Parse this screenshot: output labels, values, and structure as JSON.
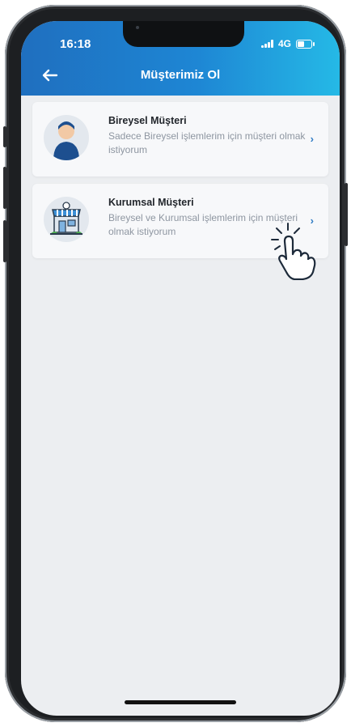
{
  "status_bar": {
    "time": "16:18",
    "network": "4G",
    "battery_level": 0.6
  },
  "header": {
    "title": "Müşterimiz Ol",
    "back_icon": "arrow-left-icon"
  },
  "options": [
    {
      "title": "Bireysel Müşteri",
      "description": "Sadece Bireysel işlemlerim için müşteri olmak istiyorum",
      "icon": "person-icon"
    },
    {
      "title": "Kurumsal Müşteri",
      "description": "Bireysel ve Kurumsal işlemlerim için müşteri olmak istiyorum",
      "icon": "storefront-icon"
    }
  ],
  "colors": {
    "header_start": "#1f6fbf",
    "header_end": "#25b9e6",
    "accent": "#2e7bc4",
    "background": "#eceef1"
  }
}
